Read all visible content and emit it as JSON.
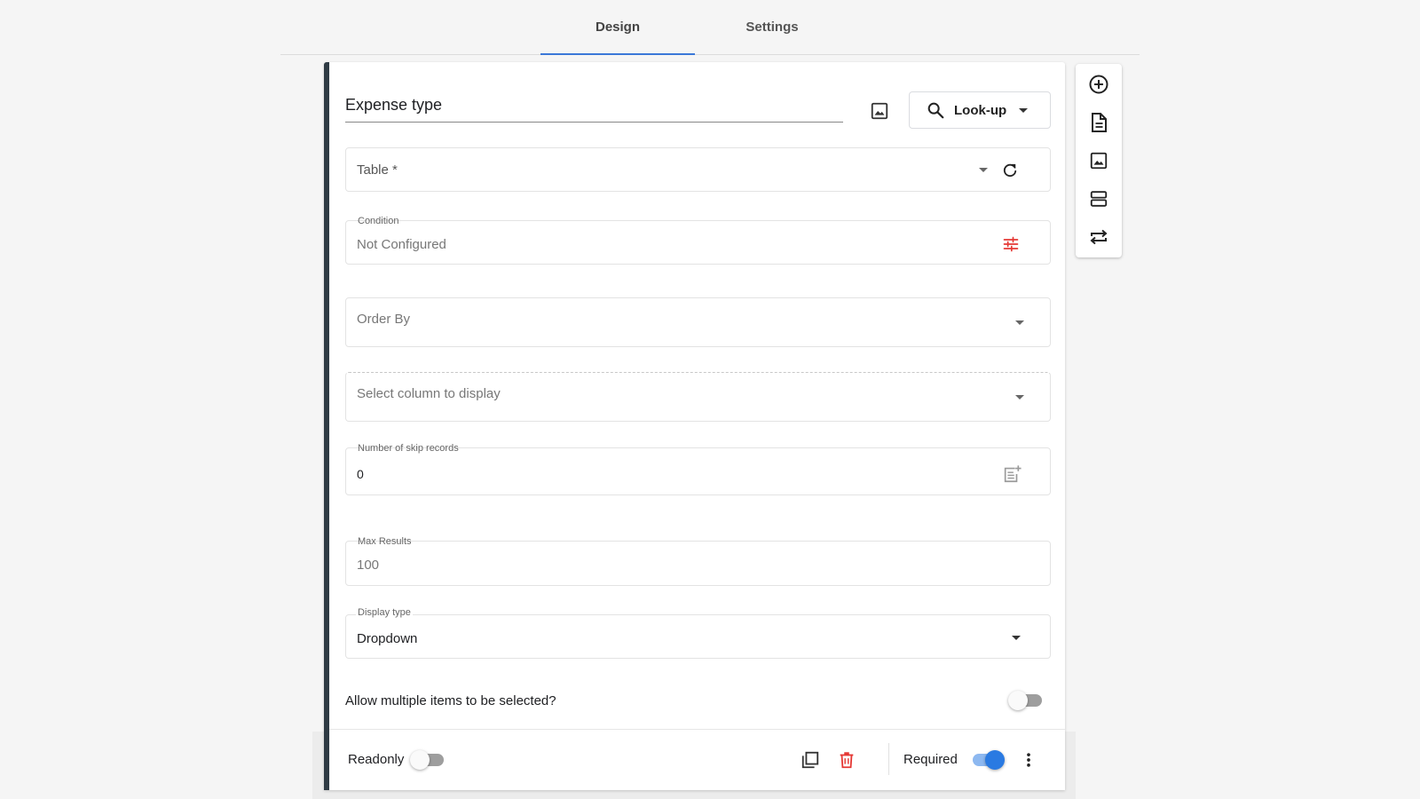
{
  "tabs": [
    {
      "label": "Design",
      "active": true
    },
    {
      "label": "Settings",
      "active": false
    }
  ],
  "question": {
    "title": "Expense type",
    "type_label": "Look-up"
  },
  "fields": {
    "table": {
      "label": "Table *"
    },
    "condition": {
      "label": "Condition",
      "value": "Not Configured"
    },
    "order_by": {
      "placeholder": "Order By"
    },
    "column": {
      "placeholder": "Select column to display"
    },
    "skip_records": {
      "label": "Number of skip records",
      "value": "0"
    },
    "max_results": {
      "label": "Max Results",
      "value": "100"
    },
    "display_type": {
      "label": "Display type",
      "value": "Dropdown"
    }
  },
  "allow_multiple": {
    "label": "Allow multiple items to be selected?",
    "enabled": false
  },
  "footer": {
    "readonly_label": "Readonly",
    "readonly_enabled": false,
    "required_label": "Required",
    "required_enabled": true
  },
  "colors": {
    "accent": "#3b78d8",
    "toggle_on": "#2a7ae2",
    "delete": "#e53935",
    "condition_icon": "#e53935",
    "card_border": "#2f3b44"
  },
  "side_toolbar": [
    "add-circle-icon",
    "document-icon",
    "image-icon",
    "section-icon",
    "swap-icon"
  ]
}
